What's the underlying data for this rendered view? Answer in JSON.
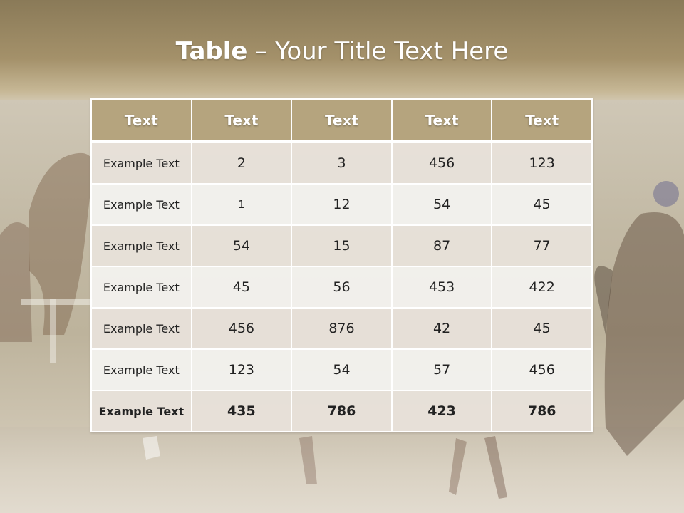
{
  "title": {
    "bold": "Table",
    "rest": " – Your Title Text Here"
  },
  "table": {
    "headers": [
      "Text",
      "Text",
      "Text",
      "Text",
      "Text"
    ],
    "rows": [
      [
        "Example Text",
        "2",
        "3",
        "456",
        "123"
      ],
      [
        "Example Text",
        "1",
        "12",
        "54",
        "45"
      ],
      [
        "Example Text",
        "54",
        "15",
        "87",
        "77"
      ],
      [
        "Example Text",
        "45",
        "56",
        "453",
        "422"
      ],
      [
        "Example Text",
        "456",
        "876",
        "42",
        "45"
      ],
      [
        "Example Text",
        "123",
        "54",
        "57",
        "456"
      ],
      [
        "Example Text",
        "435",
        "786",
        "423",
        "786"
      ]
    ]
  },
  "colors": {
    "header_bg": "#b5a47e",
    "row_odd": "#e8e2da",
    "row_even": "#f3f2ef"
  }
}
